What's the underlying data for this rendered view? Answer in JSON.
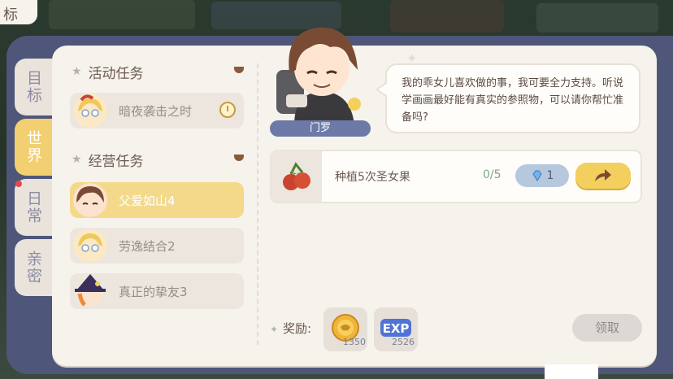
{
  "corner_tab": {
    "label": "标"
  },
  "side_tabs": [
    {
      "label": "目标",
      "active": false
    },
    {
      "label": "世界",
      "active": true
    },
    {
      "label": "日常",
      "active": false,
      "badge": true
    },
    {
      "label": "亲密",
      "active": false
    }
  ],
  "sections": {
    "activity": {
      "title": "活动任务"
    },
    "business": {
      "title": "经营任务"
    }
  },
  "tasks": [
    {
      "label": "暗夜袭击之时",
      "active": false,
      "timed": true
    },
    {
      "label": "父爱如山4",
      "active": true
    },
    {
      "label": "劳逸结合2",
      "active": false
    },
    {
      "label": "真正的挚友3",
      "active": false
    }
  ],
  "npc": {
    "name": "门罗"
  },
  "dialogue": {
    "text": "我的乖女儿喜欢做的事，我可要全力支持。听说学画画最好能有真实的参照物，可以请你帮忙准备吗?"
  },
  "objective": {
    "label": "种植5次圣女果",
    "current": "0",
    "total": "/5",
    "gem_reward": "1",
    "icon": "cherry-tomato-icon"
  },
  "reward": {
    "label": "奖励:",
    "items": [
      {
        "icon": "gold-coin-icon",
        "count": "1350"
      },
      {
        "icon": "exp-icon",
        "count": "2526",
        "badge_text": "EXP"
      }
    ],
    "claim_label": "领取"
  },
  "colors": {
    "accent": "#f3cf5d",
    "panel": "#f6f2ec",
    "frame": "#4e5679",
    "active_tab": "#f2cf70"
  }
}
